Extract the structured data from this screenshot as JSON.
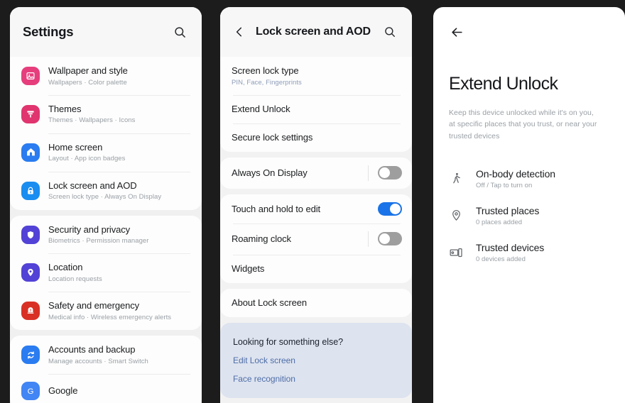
{
  "panels": {
    "settings": {
      "header": {
        "title": "Settings",
        "search_icon": "search-icon"
      },
      "groups": [
        {
          "items": [
            {
              "title": "Wallpaper and style",
              "sub": "Wallpapers  ·  Color palette",
              "icon": "wallpaper-icon",
              "color": "#e63e7d"
            },
            {
              "title": "Themes",
              "sub": "Themes  ·  Wallpapers  ·  Icons",
              "icon": "themes-brush-icon",
              "color": "#e0356f"
            },
            {
              "title": "Home screen",
              "sub": "Layout  ·  App icon badges",
              "icon": "home-icon",
              "color": "#2a7cf0"
            },
            {
              "title": "Lock screen and AOD",
              "sub": "Screen lock type  ·  Always On Display",
              "icon": "lock-icon",
              "color": "#1a8df0"
            }
          ]
        },
        {
          "items": [
            {
              "title": "Security and privacy",
              "sub": "Biometrics  ·  Permission manager",
              "icon": "shield-icon",
              "color": "#5242d6"
            },
            {
              "title": "Location",
              "sub": "Location requests",
              "icon": "location-pin-icon",
              "color": "#5242d6"
            },
            {
              "title": "Safety and emergency",
              "sub": "Medical info  ·  Wireless emergency alerts",
              "icon": "emergency-alert-icon",
              "color": "#d93025"
            }
          ]
        },
        {
          "items": [
            {
              "title": "Accounts and backup",
              "sub": "Manage accounts  ·  Smart Switch",
              "icon": "sync-accounts-icon",
              "color": "#2a7cf0"
            },
            {
              "title": "Google",
              "sub": "",
              "icon": "google-g-icon",
              "color": "#4285f4"
            }
          ]
        }
      ]
    },
    "lock": {
      "header": {
        "title": "Lock screen and AOD",
        "back_icon": "chevron-left-icon",
        "search_icon": "search-icon"
      },
      "groups": [
        {
          "items": [
            {
              "title": "Screen lock type",
              "sub": "PIN, Face, Fingerprints",
              "sub_accent": true
            },
            {
              "title": "Extend Unlock",
              "sub": ""
            },
            {
              "title": "Secure lock settings",
              "sub": ""
            }
          ]
        },
        {
          "items": [
            {
              "title": "Always On Display",
              "sub": "",
              "toggle": "off"
            }
          ]
        },
        {
          "items": [
            {
              "title": "Touch and hold to edit",
              "sub": "",
              "toggle": "on"
            },
            {
              "title": "Roaming clock",
              "sub": "",
              "toggle": "off"
            },
            {
              "title": "Widgets",
              "sub": ""
            }
          ]
        },
        {
          "items": [
            {
              "title": "About Lock screen",
              "sub": ""
            }
          ]
        }
      ],
      "suggestion": {
        "title": "Looking for something else?",
        "links": [
          "Edit Lock screen",
          "Face recognition"
        ]
      }
    },
    "extend": {
      "back_icon": "arrow-left-icon",
      "title": "Extend Unlock",
      "description": "Keep this device unlocked while it's on you, at specific places that you trust, or near your trusted devices",
      "items": [
        {
          "title": "On-body detection",
          "sub": "Off / Tap to turn on",
          "icon": "walking-person-icon"
        },
        {
          "title": "Trusted places",
          "sub": "0 places added",
          "icon": "location-pin-outline-icon"
        },
        {
          "title": "Trusted devices",
          "sub": "0 devices added",
          "icon": "devices-icon"
        }
      ]
    }
  }
}
